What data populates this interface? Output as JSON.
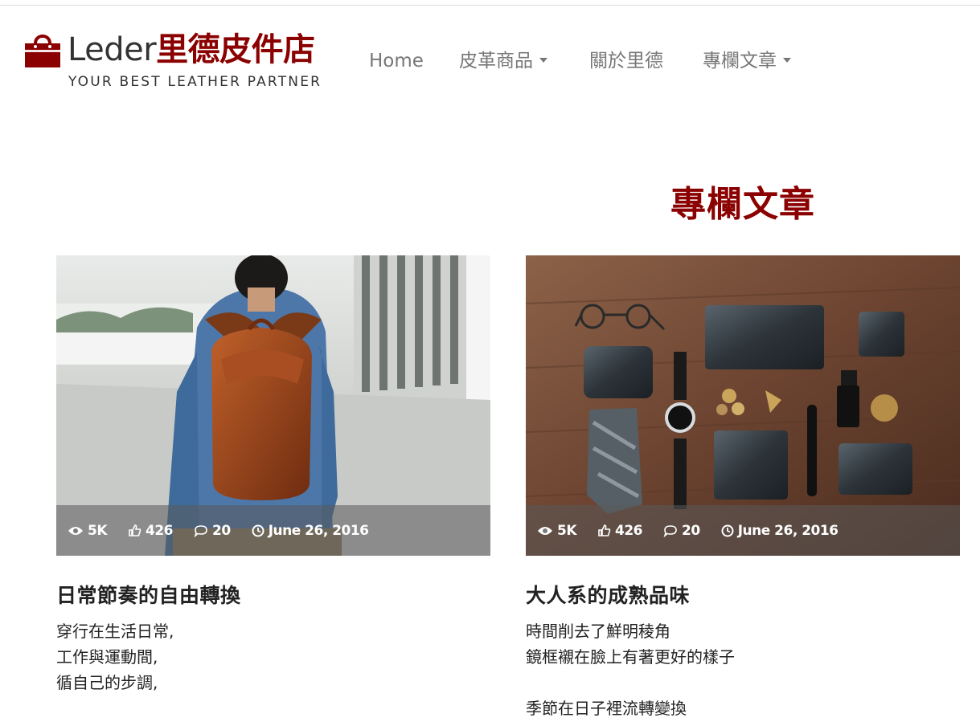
{
  "brand": {
    "name_en": "Leder",
    "name_zh": "里德皮件店",
    "tagline": "YOUR BEST LEATHER PARTNER",
    "accent_color": "#8b0000",
    "icon": "shopping-bag-icon"
  },
  "nav": {
    "items": [
      {
        "label": "Home",
        "has_dropdown": false
      },
      {
        "label": "皮革商品",
        "has_dropdown": true
      },
      {
        "label": "關於里德",
        "has_dropdown": false
      },
      {
        "label": "專欄文章",
        "has_dropdown": true
      }
    ]
  },
  "section": {
    "title": "專欄文章"
  },
  "articles": [
    {
      "image": "man-with-leather-backpack-photo",
      "views": "5K",
      "likes": "426",
      "comments": "20",
      "date": "June 26, 2016",
      "title": "日常節奏的自由轉換",
      "body": "穿行在生活日常,\n工作與運動間,\n循自己的步調,\n\n"
    },
    {
      "image": "leather-wallets-and-accessories-flatlay-photo",
      "views": "5K",
      "likes": "426",
      "comments": "20",
      "date": "June 26, 2016",
      "title": "大人系的成熟品味",
      "body": "時間削去了鮮明稜角\n鏡框襯在臉上有著更好的樣子\n\n季節在日子裡流轉變換\n"
    }
  ]
}
